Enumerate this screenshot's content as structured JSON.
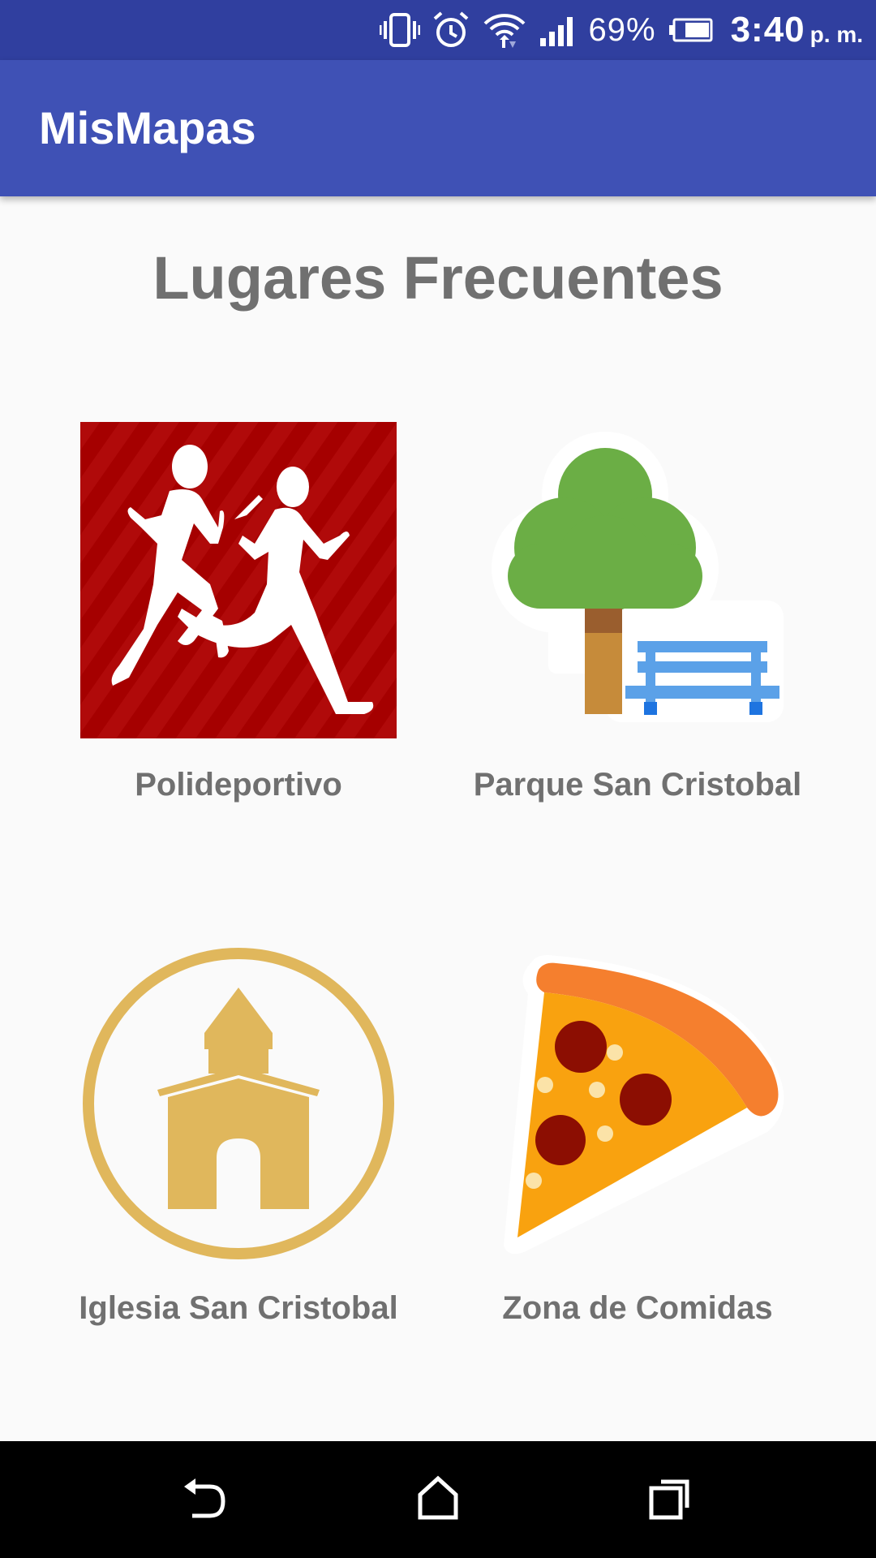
{
  "status_bar": {
    "battery_percent": "69%",
    "time": "3:40",
    "time_suffix": "p. m.",
    "icons": [
      "vibrate-icon",
      "alarm-icon",
      "wifi-icon",
      "signal-icon",
      "battery-icon"
    ]
  },
  "app_bar": {
    "title": "MisMapas",
    "color": "#3F51B5",
    "status_color": "#303F9F"
  },
  "main": {
    "heading": "Lugares Frecuentes",
    "places": [
      {
        "label": "Polideportivo",
        "icon": "runners-icon"
      },
      {
        "label": "Parque San Cristobal",
        "icon": "park-bench-icon"
      },
      {
        "label": "Iglesia San Cristobal",
        "icon": "church-icon"
      },
      {
        "label": "Zona de Comidas",
        "icon": "pizza-icon"
      }
    ]
  },
  "nav_bar": {
    "buttons": [
      "back-icon",
      "home-icon",
      "recents-icon"
    ]
  }
}
